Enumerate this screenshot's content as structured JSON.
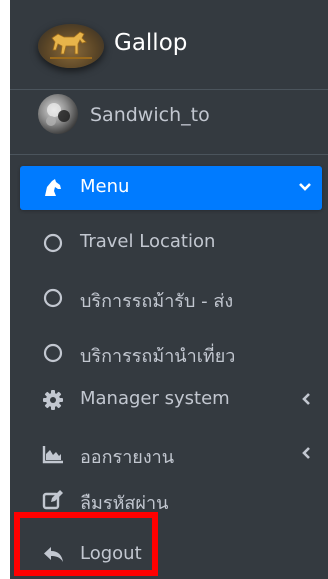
{
  "brand": {
    "name": "Gallop"
  },
  "user": {
    "name": "Sandwich_to"
  },
  "nav": {
    "items": [
      {
        "label": "Menu",
        "icon": "horse-head-icon",
        "active": true,
        "arrow": "chevron-down-icon"
      },
      {
        "label": "Travel Location",
        "icon": "circle-outline-icon"
      },
      {
        "label": "บริการรถม้ารับ - ส่ง",
        "icon": "circle-outline-icon"
      },
      {
        "label": "บริการรถม้านำเที่ยว",
        "icon": "circle-outline-icon"
      },
      {
        "label": "Manager system",
        "icon": "gear-icon",
        "arrow": "chevron-left-icon"
      },
      {
        "label": "ออกรายงาน",
        "icon": "area-chart-icon",
        "arrow": "chevron-left-icon"
      },
      {
        "label": "ลืมรหัสผ่าน",
        "icon": "edit-icon"
      },
      {
        "label": "Logout",
        "icon": "reply-icon"
      }
    ]
  },
  "colors": {
    "sidebar_bg": "#343a40",
    "text": "#c2c7d0",
    "active_bg": "#007bff",
    "highlight": "#ff0000"
  }
}
